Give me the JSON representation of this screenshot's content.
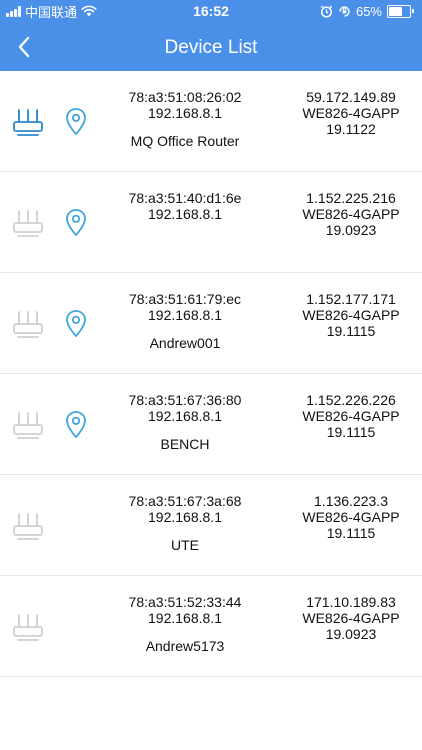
{
  "status_bar": {
    "carrier": "中国联通",
    "time": "16:52",
    "battery": "65%",
    "battery_level": 0.65
  },
  "header": {
    "title": "Device List",
    "back_icon": "chevron-left-icon"
  },
  "colors": {
    "header_bg": "#4a8fe8",
    "accent": "#3ea6dc",
    "router_active": "#2b86c9",
    "router_inactive": "#cfcfcf",
    "text": "#111111"
  },
  "devices": [
    {
      "mac": "78:a3:51:08:26:02",
      "lan_ip": "192.168.8.1",
      "name": "MQ Office Router",
      "wan_ip": "59.172.149.89",
      "model": "WE826-4GAPP",
      "version": "19.1122",
      "active": true,
      "has_location": true
    },
    {
      "mac": "78:a3:51:40:d1:6e",
      "lan_ip": "192.168.8.1",
      "name": "",
      "wan_ip": "1.152.225.216",
      "model": "WE826-4GAPP",
      "version": "19.0923",
      "active": false,
      "has_location": true
    },
    {
      "mac": "78:a3:51:61:79:ec",
      "lan_ip": "192.168.8.1",
      "name": "Andrew001",
      "wan_ip": "1.152.177.171",
      "model": "WE826-4GAPP",
      "version": "19.1115",
      "active": false,
      "has_location": true
    },
    {
      "mac": "78:a3:51:67:36:80",
      "lan_ip": "192.168.8.1",
      "name": "BENCH",
      "wan_ip": "1.152.226.226",
      "model": "WE826-4GAPP",
      "version": "19.1115",
      "active": false,
      "has_location": true
    },
    {
      "mac": "78:a3:51:67:3a:68",
      "lan_ip": "192.168.8.1",
      "name": "UTE",
      "wan_ip": "1.136.223.3",
      "model": "WE826-4GAPP",
      "version": "19.1115",
      "active": false,
      "has_location": false
    },
    {
      "mac": "78:a3:51:52:33:44",
      "lan_ip": "192.168.8.1",
      "name": "Andrew5173",
      "wan_ip": "171.10.189.83",
      "model": "WE826-4GAPP",
      "version": "19.0923",
      "active": false,
      "has_location": false
    }
  ]
}
